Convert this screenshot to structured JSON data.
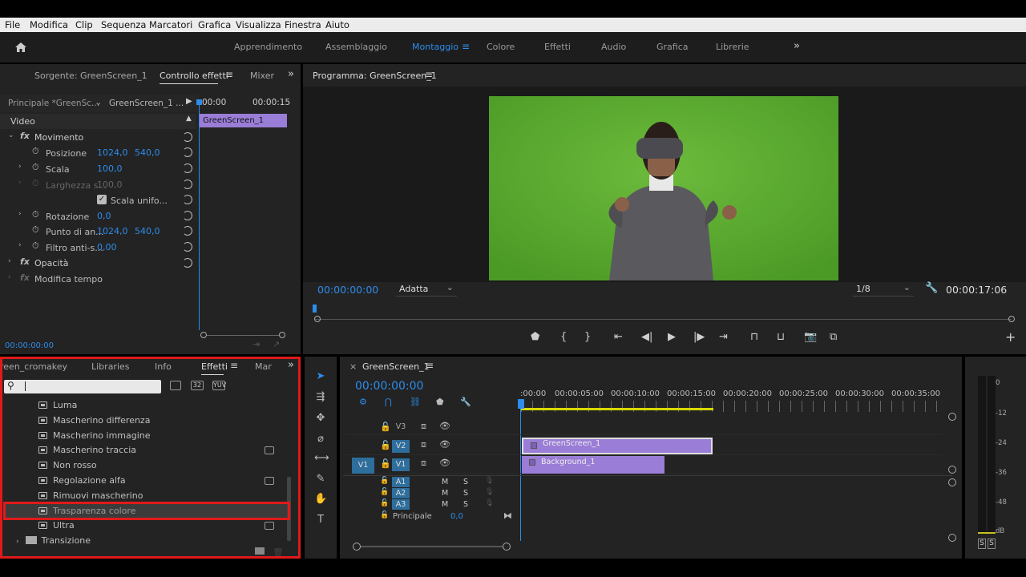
{
  "menu": [
    "File",
    "Modifica",
    "Clip",
    "Sequenza",
    "Marcatori",
    "Grafica",
    "Visualizza",
    "Finestra",
    "Aiuto"
  ],
  "workspaces": [
    "Apprendimento",
    "Assemblaggio",
    "Montaggio",
    "Colore",
    "Effetti",
    "Audio",
    "Grafica",
    "Librerie"
  ],
  "active_workspace": "Montaggio",
  "source_panel": {
    "tabs": [
      "Sorgente: GreenScreen_1",
      "Controllo effetti",
      "Mixer"
    ],
    "master_label": "Principale *GreenSc...",
    "clip_label": "GreenScreen_1 ...",
    "time_start": "00:00",
    "time_end": "00:00:15",
    "mini_clip": "GreenScreen_1",
    "section_video": "Video",
    "movimento": "Movimento",
    "props": [
      {
        "name": "Posizione",
        "v1": "1024,0",
        "v2": "540,0"
      },
      {
        "name": "Scala",
        "v1": "100,0",
        "v2": ""
      },
      {
        "name": "Larghezza s...",
        "v1": "100,0",
        "v2": ""
      },
      {
        "name": "Scala unifo...",
        "v1": "",
        "v2": ""
      },
      {
        "name": "Rotazione",
        "v1": "0,0",
        "v2": ""
      },
      {
        "name": "Punto di an...",
        "v1": "1024,0",
        "v2": "540,0"
      },
      {
        "name": "Filtro anti-s...",
        "v1": "0,00",
        "v2": ""
      }
    ],
    "opacita": "Opacità",
    "modifica_tempo": "Modifica tempo",
    "timecode": "00:00:00:00"
  },
  "program": {
    "title": "Programma: GreenScreen_1",
    "timecode": "00:00:00:00",
    "fit": "Adatta",
    "resolution": "1/8",
    "duration": "00:00:17:06"
  },
  "effects_panel": {
    "tabs": [
      "reen_cromakey",
      "Libraries",
      "Info",
      "Effetti",
      "Mar"
    ],
    "items": [
      "Luma",
      "Mascherino differenza",
      "Mascherino immagine",
      "Mascherino traccia",
      "Non rosso",
      "Regolazione alfa",
      "Rimuovi mascherino",
      "Trasparenza colore",
      "Ultra"
    ],
    "folder": "Transizione"
  },
  "timeline": {
    "title": "GreenScreen_1",
    "timecode": "00:00:00:00",
    "ruler": [
      ":00:00",
      "00:00:05:00",
      "00:00:10:00",
      "00:00:15:00",
      "00:00:20:00",
      "00:00:25:00",
      "00:00:30:00",
      "00:00:35:00"
    ],
    "tracks": [
      "V3",
      "V2",
      "V1",
      "A1",
      "A2",
      "A3"
    ],
    "source_patch": "V1",
    "ms": [
      "M",
      "S"
    ],
    "master": "Principale",
    "master_value": "0,0",
    "clips": [
      "GreenScreen_1",
      "Background_1"
    ]
  },
  "meter": {
    "labels": [
      "0",
      "-12",
      "-24",
      "-36",
      "-48",
      "dB"
    ],
    "solo": [
      "S",
      "S"
    ]
  }
}
